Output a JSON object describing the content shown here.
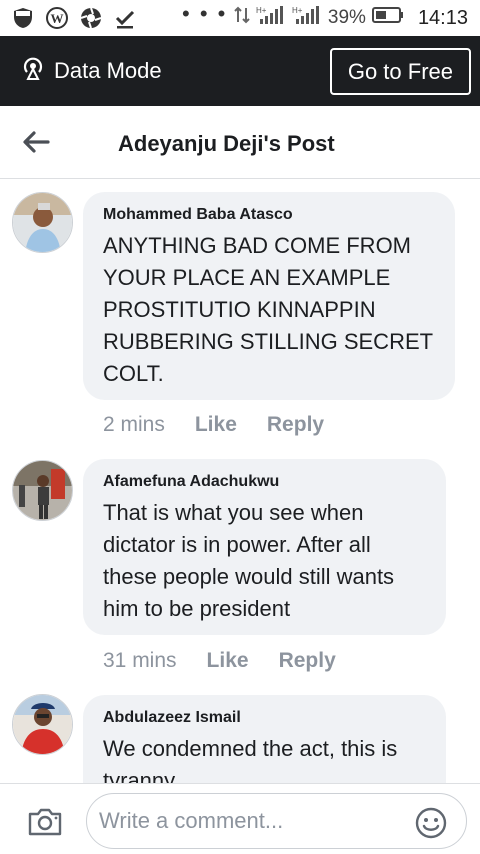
{
  "status_bar": {
    "icons": [
      "shield-icon",
      "wordpress-icon",
      "aperture-icon",
      "download-done-icon"
    ],
    "dots": "• • •",
    "battery": "39%",
    "time": "14:13"
  },
  "data_bar": {
    "label": "Data Mode",
    "button": "Go to Free"
  },
  "header": {
    "title": "Adeyanju Deji's Post"
  },
  "comments": [
    {
      "name": "Mohammed Baba Atasco",
      "text": "ANYTHING BAD COME FROM YOUR PLACE AN EXAMPLE PROSTITUTIO KINNAPPIN RUBBERING STILLING SECRET COLT.",
      "time": "2 mins",
      "like": "Like",
      "reply": "Reply"
    },
    {
      "name": "Afamefuna Adachukwu",
      "text": "That is what you see when dictator is in power. After all these people would still wants him to be president",
      "time": "31 mins",
      "like": "Like",
      "reply": "Reply"
    },
    {
      "name": "Abdulazeez Ismail",
      "text": "We condemned the act, this is tyranny"
    }
  ],
  "composer": {
    "placeholder": "Write a comment..."
  },
  "colors": {
    "data_bar": "#1c1e21",
    "bubble": "#f0f2f5",
    "muted": "#8d949e"
  }
}
